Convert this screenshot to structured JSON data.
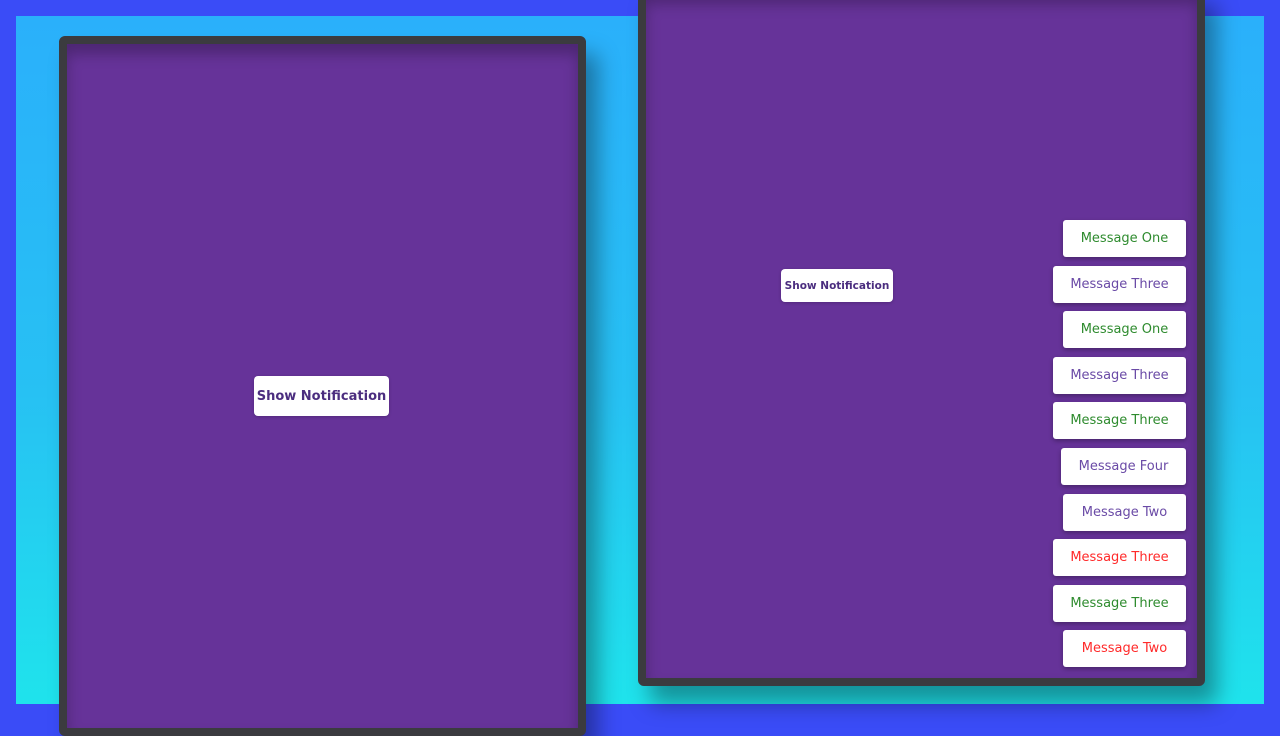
{
  "colors": {
    "outer_border": "#3a4cf7",
    "panel_background": "#663399",
    "panel_frame": "#3b3b3f",
    "success": "#2e8b2e",
    "info": "#6a4aa6",
    "error": "#ff2a2a"
  },
  "left_panel": {
    "button_label": "Show Notification"
  },
  "right_panel": {
    "button_label": "Show Notification",
    "notifications": [
      {
        "text": "Message One",
        "type": "success"
      },
      {
        "text": "Message Three",
        "type": "info"
      },
      {
        "text": "Message One",
        "type": "success"
      },
      {
        "text": "Message Three",
        "type": "info"
      },
      {
        "text": "Message Three",
        "type": "success"
      },
      {
        "text": "Message Four",
        "type": "info"
      },
      {
        "text": "Message Two",
        "type": "info"
      },
      {
        "text": "Message Three",
        "type": "error"
      },
      {
        "text": "Message Three",
        "type": "success"
      },
      {
        "text": "Message Two",
        "type": "error"
      }
    ]
  }
}
